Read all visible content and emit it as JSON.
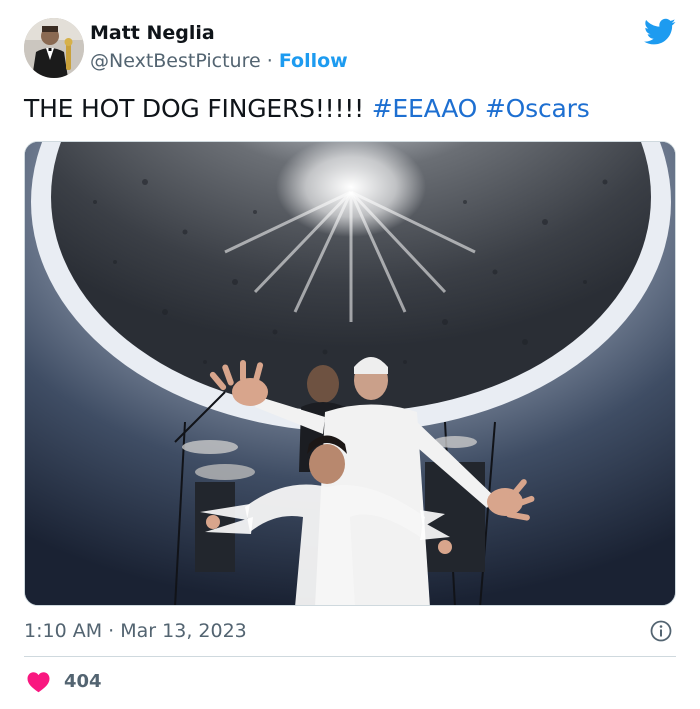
{
  "user": {
    "name": "Matt Neglia",
    "handle": "@NextBestPicture",
    "separator": "·",
    "follow_label": "Follow"
  },
  "tweet": {
    "text": "THE HOT DOG FINGERS!!!!!",
    "hashtags": [
      "#EEAAO",
      "#Oscars"
    ]
  },
  "meta": {
    "time": "1:10 AM",
    "separator": "·",
    "date": "Mar 13, 2023"
  },
  "engagement": {
    "likes": "404"
  },
  "colors": {
    "accent": "#1d9bf0",
    "like": "#f91880",
    "muted": "#536471"
  },
  "icons": {
    "brand": "twitter-bird-icon",
    "info": "info-icon",
    "like": "heart-icon"
  }
}
